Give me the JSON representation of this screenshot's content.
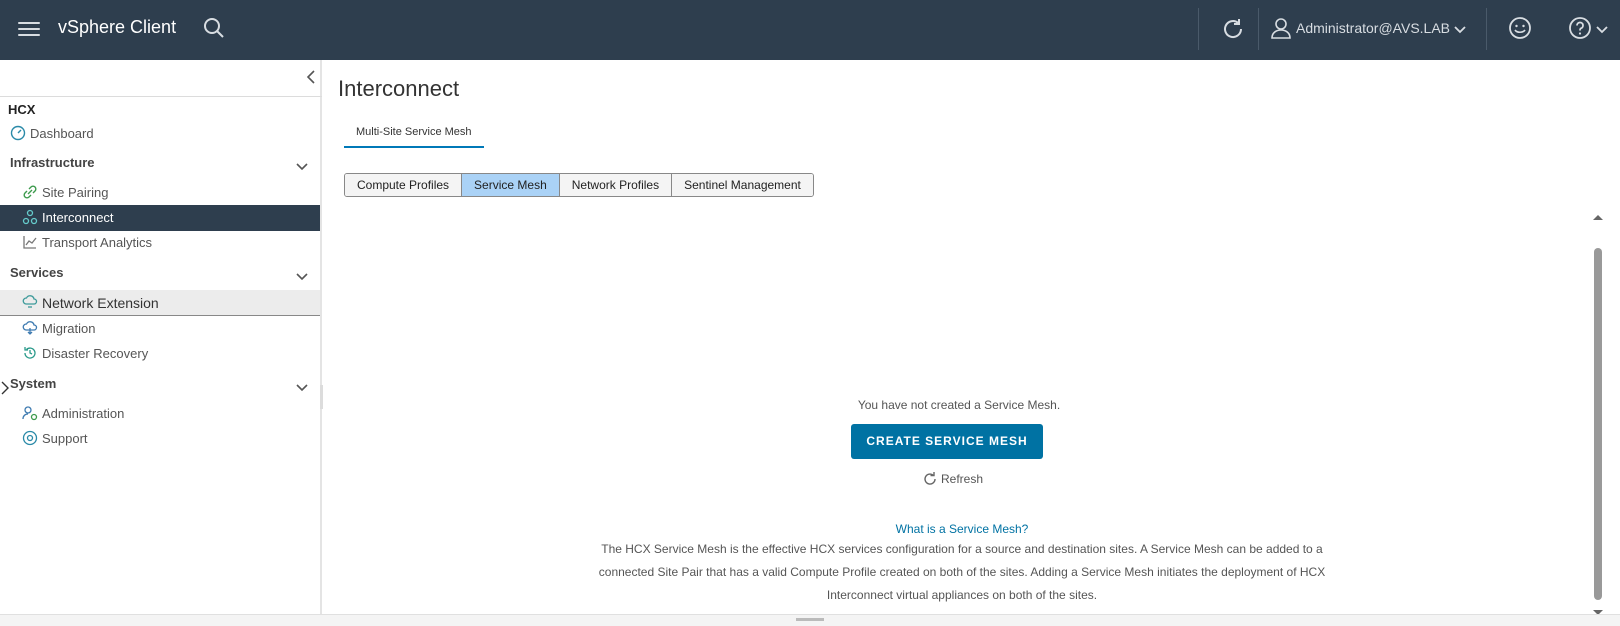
{
  "header": {
    "app_title": "vSphere Client",
    "user": "Administrator@AVS.LAB",
    "icons": [
      "menu-icon",
      "search-icon",
      "refresh-icon",
      "user-icon",
      "smiley-icon",
      "help-icon"
    ]
  },
  "sidebar": {
    "root": "HCX",
    "dashboard": "Dashboard",
    "sections": [
      {
        "label": "Infrastructure",
        "items": [
          "Site Pairing",
          "Interconnect",
          "Transport Analytics"
        ]
      },
      {
        "label": "Services",
        "items": [
          "Network Extension",
          "Migration",
          "Disaster Recovery"
        ]
      },
      {
        "label": "System",
        "items": [
          "Administration",
          "Support"
        ]
      }
    ],
    "selected": "Interconnect"
  },
  "main": {
    "title": "Interconnect",
    "top_tab": "Multi-Site Service Mesh",
    "segments": [
      "Compute Profiles",
      "Service Mesh",
      "Network Profiles",
      "Sentinel Management"
    ],
    "active_segment": "Service Mesh",
    "empty_message": "You have not created a Service Mesh.",
    "create_button": "CREATE SERVICE MESH",
    "refresh_label": "Refresh",
    "info_link": "What is a Service Mesh?",
    "description": "The HCX Service Mesh is the effective HCX services configuration for a source and destination sites. A Service Mesh can be added to a connected Site Pair that has a valid Compute Profile created on both of the sites. Adding a Service Mesh initiates the deployment of HCX Interconnect virtual appliances on both of the sites."
  },
  "colors": {
    "header_bg": "#2e3e4e",
    "selected_bg": "#2e3e4e",
    "primary_button": "#0072a3",
    "active_segment": "#aad2f6",
    "link": "#0072a3"
  }
}
